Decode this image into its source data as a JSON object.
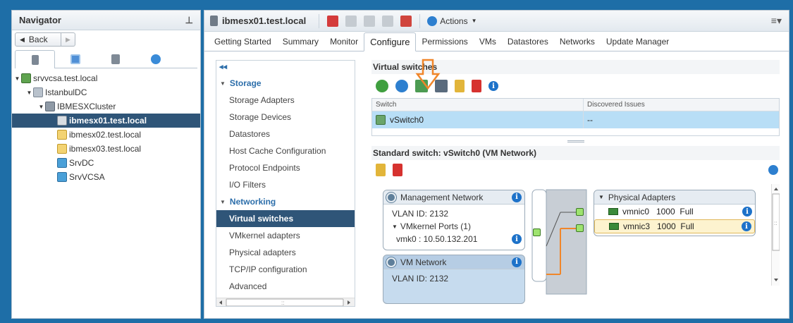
{
  "navigator": {
    "title": "Navigator",
    "back_label": "Back",
    "tree": [
      {
        "label": "srvvcsa.test.local",
        "level": 0,
        "expanded": true,
        "type": "vcenter"
      },
      {
        "label": "IstanbulDC",
        "level": 1,
        "expanded": true,
        "type": "datacenter"
      },
      {
        "label": "IBMESXCluster",
        "level": 2,
        "expanded": true,
        "type": "cluster"
      },
      {
        "label": "ibmesx01.test.local",
        "level": 3,
        "selected": true,
        "type": "host"
      },
      {
        "label": "ibmesx02.test.local",
        "level": 3,
        "type": "host-warn"
      },
      {
        "label": "ibmesx03.test.local",
        "level": 3,
        "type": "host-warn"
      },
      {
        "label": "SrvDC",
        "level": 3,
        "type": "vm"
      },
      {
        "label": "SrvVCSA",
        "level": 3,
        "type": "vm"
      }
    ]
  },
  "main": {
    "host_title": "ibmesx01.test.local",
    "actions_label": "Actions",
    "tabs": [
      {
        "label": "Getting Started"
      },
      {
        "label": "Summary"
      },
      {
        "label": "Monitor"
      },
      {
        "label": "Configure",
        "active": true
      },
      {
        "label": "Permissions"
      },
      {
        "label": "VMs"
      },
      {
        "label": "Datastores"
      },
      {
        "label": "Networks"
      },
      {
        "label": "Update Manager"
      }
    ]
  },
  "settings_menu": {
    "collapse": "◂◂",
    "sections": [
      {
        "label": "Storage",
        "items": [
          "Storage Adapters",
          "Storage Devices",
          "Datastores",
          "Host Cache Configuration",
          "Protocol Endpoints",
          "I/O Filters"
        ]
      },
      {
        "label": "Networking",
        "items": [
          "Virtual switches",
          "VMkernel adapters",
          "Physical adapters",
          "TCP/IP configuration",
          "Advanced"
        ]
      }
    ],
    "active_item": "Virtual switches"
  },
  "virtual_switches": {
    "title": "Virtual switches",
    "columns": [
      "Switch",
      "Discovered Issues"
    ],
    "rows": [
      {
        "switch": "vSwitch0",
        "issues": "--"
      }
    ]
  },
  "standard_switch": {
    "title": "Standard switch: vSwitch0 (VM Network)",
    "mgmt": {
      "name": "Management Network",
      "vlan": "VLAN ID: 2132",
      "ports": "VMkernel Ports (1)",
      "vmk": "vmk0 : 10.50.132.201"
    },
    "vmnet": {
      "name": "VM Network",
      "vlan": "VLAN ID: 2132"
    },
    "physical": {
      "title": "Physical Adapters",
      "nics": [
        "vmnic0   1000  Full",
        "vmnic3   1000  Full"
      ]
    }
  },
  "colors": {
    "selected": "#2f5578",
    "row_highlight": "#b8def6",
    "accent": "#2c6eaa",
    "annotation_arrow": "#f0862a",
    "uplink_line": "#f0862a"
  }
}
